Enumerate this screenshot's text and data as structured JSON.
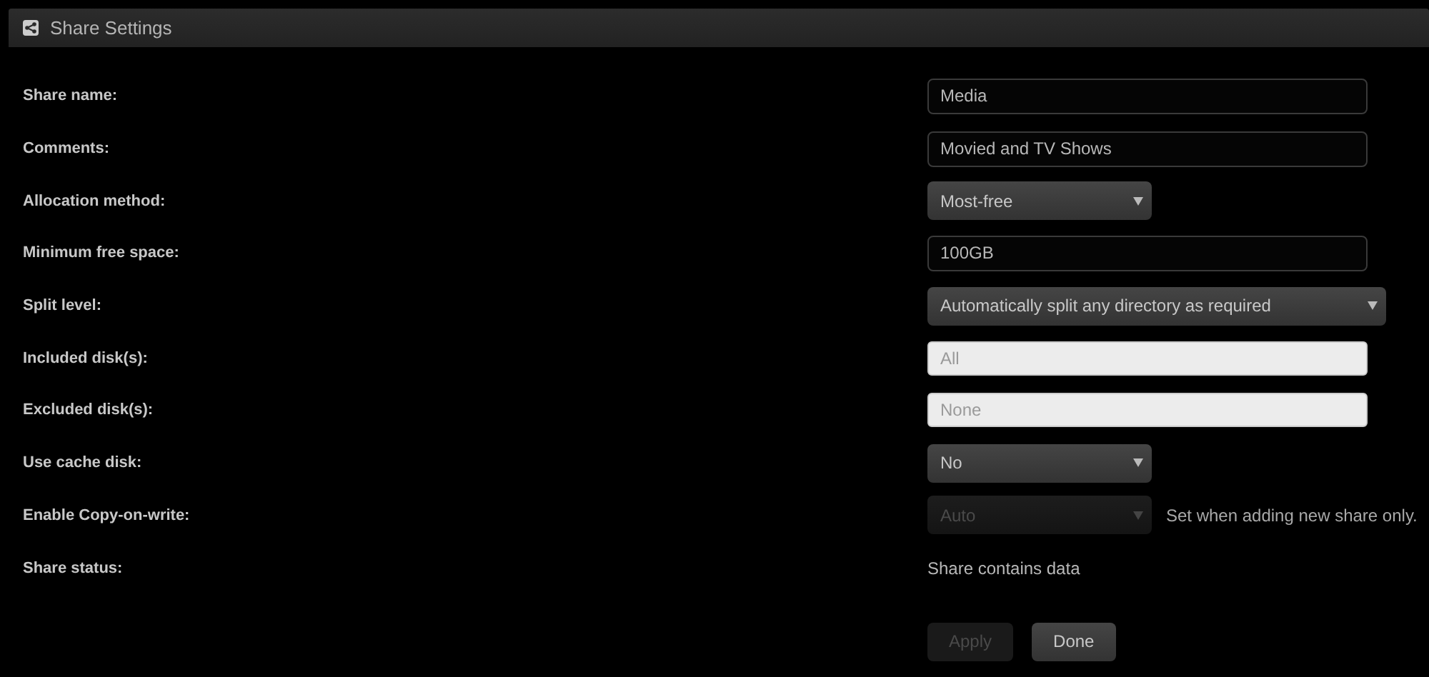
{
  "header": {
    "title": "Share Settings"
  },
  "rows": [
    {
      "label": "Share name:",
      "kind": "text",
      "value": "Media"
    },
    {
      "label": "Comments:",
      "kind": "text",
      "value": "Movied and TV Shows"
    },
    {
      "label": "Allocation method:",
      "kind": "select",
      "value": "Most-free",
      "disabled": false
    },
    {
      "label": "Minimum free space:",
      "kind": "text",
      "value": "100GB"
    },
    {
      "label": "Split level:",
      "kind": "wide-select",
      "value": "Automatically split any directory as required",
      "disabled": false
    },
    {
      "label": "Included disk(s):",
      "kind": "picker",
      "placeholder": "All"
    },
    {
      "label": "Excluded disk(s):",
      "kind": "picker",
      "placeholder": "None"
    },
    {
      "label": "Use cache disk:",
      "kind": "select",
      "value": "No",
      "disabled": false
    },
    {
      "label": "Enable Copy-on-write:",
      "kind": "select",
      "value": "Auto",
      "disabled": true,
      "note": "Set when adding new share only."
    },
    {
      "label": "Share status:",
      "kind": "status",
      "value": "Share contains data"
    }
  ],
  "buttons": [
    {
      "label": "Apply",
      "disabled": true
    },
    {
      "label": "Done",
      "disabled": false
    }
  ]
}
